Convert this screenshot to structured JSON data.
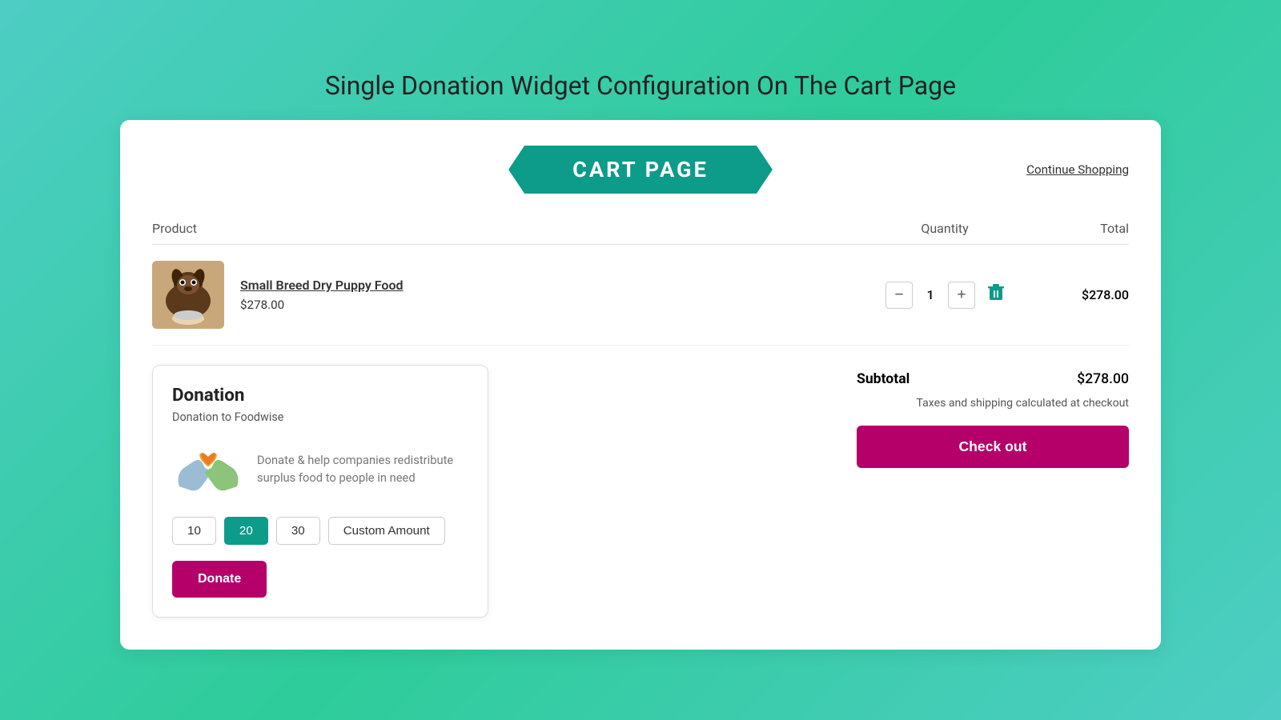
{
  "page": {
    "title": "Single Donation Widget Configuration On The Cart Page"
  },
  "header": {
    "banner_text": "CART PAGE",
    "continue_shopping": "Continue Shopping"
  },
  "table": {
    "columns": {
      "product": "Product",
      "quantity": "Quantity",
      "total": "Total"
    }
  },
  "product": {
    "name": "Small Breed Dry Puppy Food",
    "price": "$278.00",
    "quantity": 1,
    "total": "$278.00"
  },
  "donation": {
    "title": "Donation",
    "subtitle": "Donation to Foodwise",
    "description": "Donate & help companies redistribute surplus food to people in need",
    "amounts": [
      {
        "value": "10",
        "label": "10",
        "active": false
      },
      {
        "value": "20",
        "label": "20",
        "active": true
      },
      {
        "value": "30",
        "label": "30",
        "active": false
      }
    ],
    "custom_amount_placeholder": "Custom Amount",
    "donate_button": "Donate"
  },
  "summary": {
    "subtotal_label": "Subtotal",
    "subtotal_value": "$278.00",
    "tax_note": "Taxes and shipping calculated at checkout",
    "checkout_button": "Check out"
  },
  "icons": {
    "minus": "−",
    "plus": "+",
    "trash": "🗑"
  }
}
